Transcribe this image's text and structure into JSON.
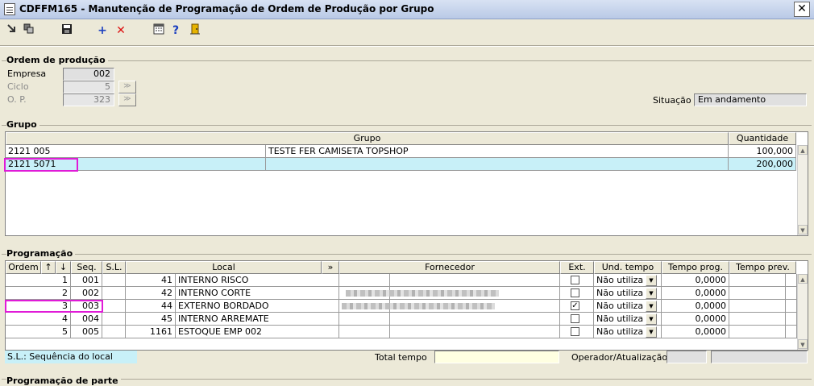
{
  "window": {
    "title": "CDFFM165 - Manutenção de Programação de Ordem de Produção por Grupo",
    "close_glyph": "✕"
  },
  "toolbar": {
    "icons": [
      "first-record-icon",
      "copy-icon",
      "save-icon",
      "add-icon",
      "delete-icon",
      "calculator-icon",
      "help-icon",
      "exit-door-icon"
    ],
    "add_glyph": "+",
    "delete_glyph": "✕",
    "help_glyph": "?"
  },
  "ordem": {
    "section_title": "Ordem de produção",
    "empresa_label": "Empresa",
    "empresa_value": "002",
    "ciclo_label": "Ciclo",
    "ciclo_value": "5",
    "op_label": "O. P.",
    "op_value": "323",
    "search_glyph": "≫",
    "situacao_label": "Situação",
    "situacao_value": "Em andamento"
  },
  "grupo": {
    "section_title": "Grupo",
    "headers": [
      "Grupo",
      "Quantidade"
    ],
    "rows": [
      {
        "code": "2121 005",
        "name": "TESTE FER CAMISETA TOPSHOP",
        "qty": "100,000"
      },
      {
        "code": "2121 5071",
        "name": "",
        "qty": "200,000"
      }
    ]
  },
  "programacao": {
    "section_title": "Programação",
    "headers": {
      "ordem": "Ordem",
      "up": "↑",
      "down": "↓",
      "seq": "Seq.",
      "sl": "S.L.",
      "local": "Local",
      "expand": "»",
      "fornecedor": "Fornecedor",
      "ext": "Ext.",
      "und_tempo": "Und. tempo",
      "tempo_prog": "Tempo prog.",
      "tempo_prev": "Tempo prev."
    },
    "rows": [
      {
        "ordem": "1",
        "seq": "001",
        "code": "41",
        "local": "INTERNO RISCO",
        "ext": "",
        "und": "Não utiliza",
        "prog": "0,0000"
      },
      {
        "ordem": "2",
        "seq": "002",
        "code": "42",
        "local": "INTERNO CORTE",
        "ext": "",
        "und": "Não utiliza",
        "prog": "0,0000"
      },
      {
        "ordem": "3",
        "seq": "003",
        "code": "44",
        "local": "EXTERNO BORDADO",
        "ext": "✓",
        "und": "Não utiliza",
        "prog": "0,0000"
      },
      {
        "ordem": "4",
        "seq": "004",
        "code": "45",
        "local": "INTERNO ARREMATE",
        "ext": "",
        "und": "Não utiliza",
        "prog": "0,0000"
      },
      {
        "ordem": "5",
        "seq": "005",
        "code": "1161",
        "local": "ESTOQUE EMP 002",
        "ext": "",
        "und": "Não utiliza",
        "prog": "0,0000"
      }
    ],
    "dropdown_glyph": "▼"
  },
  "footer": {
    "sl_legend": "S.L.: Sequência do local",
    "total_tempo_label": "Total tempo",
    "operador_label": "Operador/Atualização",
    "next_section": "Programação de parte"
  },
  "scroll": {
    "up_glyph": "▲",
    "down_glyph": "▼"
  },
  "colors": {
    "highlight": "#e01bd7",
    "selected_row": "#c8f0f8",
    "legend_bg": "#c8f0f8",
    "total_field_bg": "#ffffe1"
  }
}
